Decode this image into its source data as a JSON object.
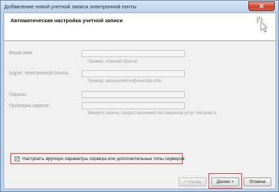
{
  "window": {
    "title": "Добавление новой учетной записи электронной почты",
    "close_glyph": "✕"
  },
  "header": {
    "title": "Автоматическая настройка учетной записи",
    "icon": "wizard-sparkle-cursor-icon"
  },
  "form": {
    "name_label": "Ваше имя:",
    "name_value": "",
    "name_hint": "Пример: Алексей Орехов",
    "email_label": "Адрес электронной почты:",
    "email_value": "",
    "email_hint": "Пример: alexeyorekhov@example.com",
    "password_label": "Пароль:",
    "password_value": "",
    "confirm_label": "Проверка пароля:",
    "confirm_value": "",
    "password_hint": "Введите пароль, предоставленный поставщиком услуг Интернета."
  },
  "manual_setup": {
    "checked": true,
    "check_glyph": "✓",
    "label": "Настроить вручную параметры сервера или дополнительные типы серверов"
  },
  "buttons": {
    "back": "< Назад",
    "next": "Далее >",
    "cancel": "Отмена"
  },
  "colors": {
    "highlight": "#e0333a",
    "chrome": "#bcd3ea"
  }
}
